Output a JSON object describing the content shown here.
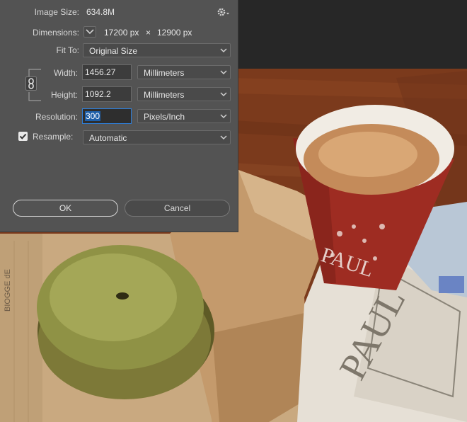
{
  "dialog": {
    "image_size": {
      "label": "Image Size:",
      "value": "634.8M"
    },
    "dimensions": {
      "label": "Dimensions:",
      "width": "17200 px",
      "times": "×",
      "height": "12900 px"
    },
    "fit_to": {
      "label": "Fit To:",
      "value": "Original Size"
    },
    "width": {
      "label": "Width:",
      "value": "1456.27",
      "unit": "Millimeters"
    },
    "height": {
      "label": "Height:",
      "value": "1092.2",
      "unit": "Millimeters"
    },
    "resolution": {
      "label": "Resolution:",
      "value": "300",
      "unit": "Pixels/Inch"
    },
    "resample": {
      "label": "Resample:",
      "checked": true,
      "value": "Automatic"
    },
    "ok_label": "OK",
    "cancel_label": "Cancel",
    "icons": {
      "settings": "gear-icon",
      "link": "chain-link-icon",
      "dropdown": "chevron-down-icon",
      "check": "checkmark-icon"
    }
  },
  "photo": {
    "cup_text": "PAUL",
    "napkin_text": "PAUL",
    "paper_text": "BIOGGE dE"
  },
  "colors": {
    "panel": "#535353",
    "field": "#4a4a4a",
    "focus": "#2f7ed8"
  }
}
